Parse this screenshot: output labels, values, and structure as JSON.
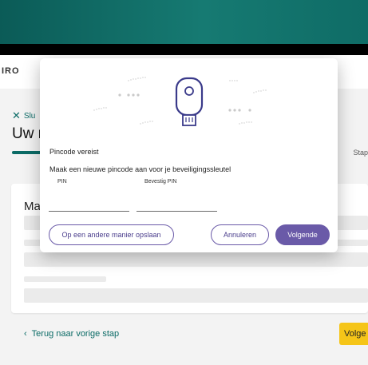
{
  "app": {
    "brand_text": "IRO"
  },
  "page": {
    "close_label": "Slu",
    "title": "Uw r",
    "step_label": "Stap",
    "card_title": "Ma",
    "back_link_label": "Terug naar vorige stap",
    "next_button_label": "Volge"
  },
  "dialog": {
    "title": "Pincode vereist",
    "description": "Maak een nieuwe pincode aan voor je beveiligingssleutel",
    "pin_label": "PIN",
    "confirm_pin_label": "Bevestig PIN",
    "pin_value": "",
    "confirm_pin_value": "",
    "other_method_button": "Op een andere manier opslaan",
    "cancel_button": "Annuleren",
    "next_button": "Volgende",
    "illustration_icon": "security-key-icon"
  },
  "colors": {
    "header_teal": "#0f6c66",
    "accent_teal": "#0b6b66",
    "primary_purple": "#6a5aa8",
    "cta_yellow": "#f5c518"
  }
}
